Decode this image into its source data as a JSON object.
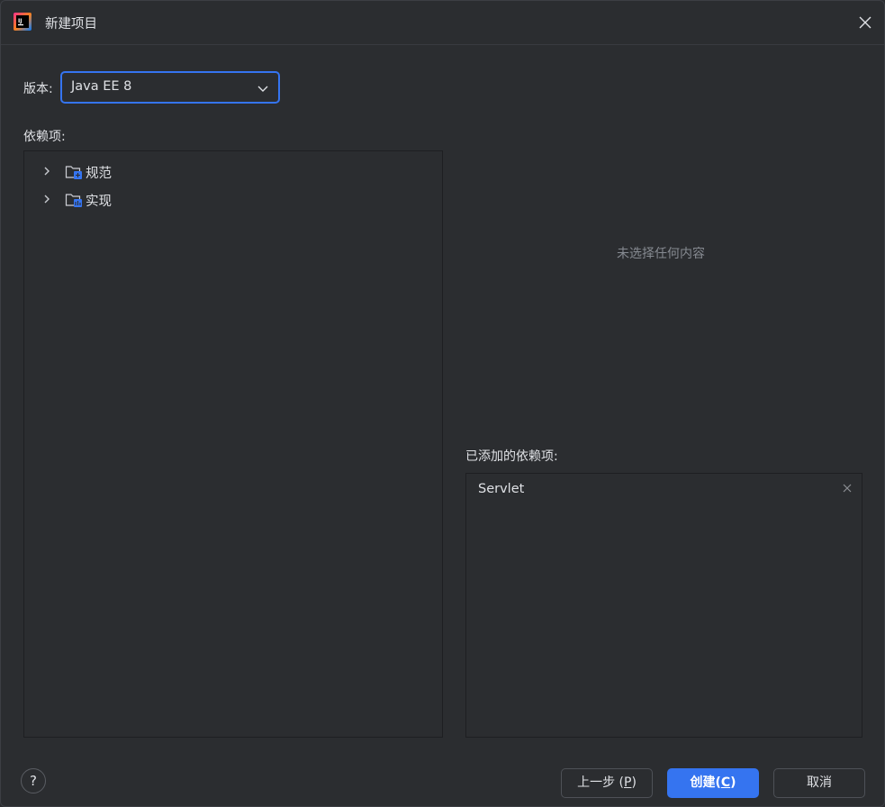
{
  "window": {
    "title": "新建项目"
  },
  "version": {
    "label": "版本:",
    "selected": "Java EE 8"
  },
  "dependencies": {
    "label": "依赖项:",
    "tree": [
      {
        "label": "规范",
        "icon": "folder-spec-icon"
      },
      {
        "label": "实现",
        "icon": "folder-impl-icon"
      }
    ]
  },
  "details": {
    "empty_text": "未选择任何内容"
  },
  "added": {
    "label": "已添加的依赖项:",
    "items": [
      "Servlet"
    ]
  },
  "buttons": {
    "help": "?",
    "prev_text": "上一步 (",
    "prev_mnemonic": "P",
    "prev_close": ")",
    "create_text": "创建(",
    "create_mnemonic": "C",
    "create_close": ")",
    "cancel": "取消"
  },
  "colors": {
    "accent": "#3574f0",
    "background": "#2b2d30"
  }
}
